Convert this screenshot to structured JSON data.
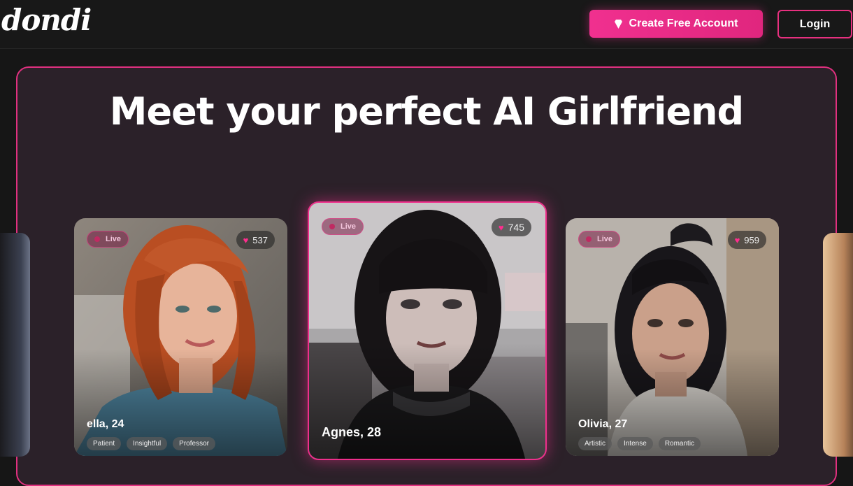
{
  "header": {
    "logo": "dondi",
    "create_account_label": "Create Free Account",
    "login_label": "Login"
  },
  "hero": {
    "title": "Meet your perfect AI Girlfriend"
  },
  "cards": [
    {
      "name": "ella, 24",
      "status": "Live",
      "likes": "537",
      "tags": [
        "Patient",
        "Insightful",
        "Professor"
      ]
    },
    {
      "name": "Agnes, 28",
      "status": "Live",
      "likes": "745",
      "tags": []
    },
    {
      "name": "Olivia, 27",
      "status": "Live",
      "likes": "959",
      "tags": [
        "Artistic",
        "Intense",
        "Romantic"
      ]
    }
  ],
  "colors": {
    "accent": "#f0308f",
    "background": "#161616",
    "hero_bg": "#2b2129"
  },
  "icons": {
    "create_account": "diamond-icon",
    "likes": "heart-icon"
  }
}
